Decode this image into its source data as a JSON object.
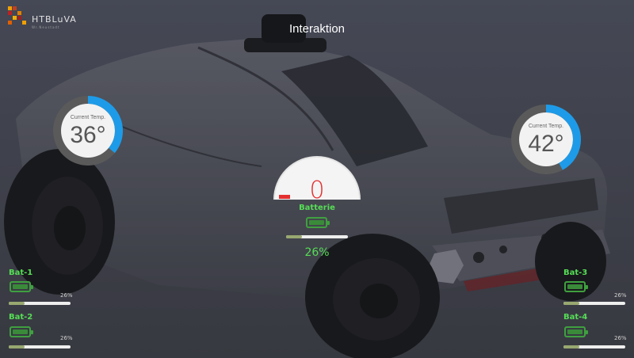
{
  "app": {
    "logo_text": "HTBLuVA",
    "logo_sub": "Wr.Neustadt",
    "title": "Interaktion"
  },
  "gauges": {
    "left": {
      "label": "Current Temp.",
      "value": "36°",
      "level": 0.36
    },
    "right": {
      "label": "Current Temp.",
      "value": "42°",
      "level": 0.42
    }
  },
  "main_battery": {
    "dial_value": "0",
    "label": "Batterie",
    "percent_text": "26%",
    "level": 0.26
  },
  "batteries": [
    {
      "name": "Bat-1",
      "percent_text": "26%",
      "level": 0.26
    },
    {
      "name": "Bat-2",
      "percent_text": "26%",
      "level": 0.26
    },
    {
      "name": "Bat-3",
      "percent_text": "26%",
      "level": 0.26
    },
    {
      "name": "Bat-4",
      "percent_text": "26%",
      "level": 0.26
    }
  ],
  "colors": {
    "accent_blue": "#1e9be8",
    "battery_green": "#55dd55",
    "alert_red": "#e53030",
    "background": "#4b4d5a"
  }
}
